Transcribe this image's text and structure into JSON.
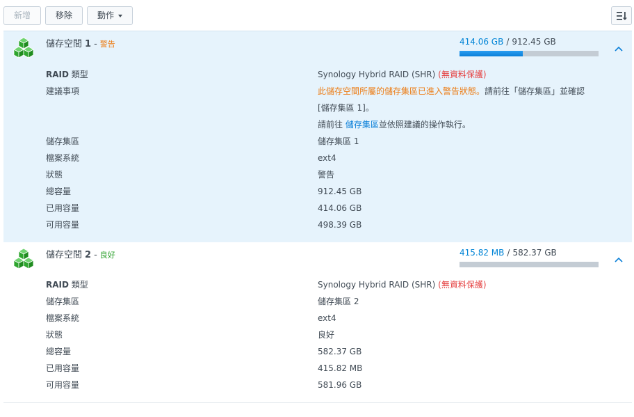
{
  "toolbar": {
    "create_label": "新增",
    "remove_label": "移除",
    "action_label": "動作"
  },
  "volumes": [
    {
      "title": "儲存空間",
      "number": "1",
      "status": "警告",
      "usage_used": "414.06 GB",
      "usage_total": "912.45 GB",
      "usage_fraction": 0.454,
      "raid_key_bold": "RAID",
      "raid_key_rest": "類型",
      "raid_value": "Synology Hybrid RAID (SHR)",
      "raid_note": "(無資料保護)",
      "suggest_key": "建議事項",
      "suggest_line1_warn": "此儲存空間所屬的儲存集區已進入警告狀態。",
      "suggest_line1_rest": "請前往「儲存集區」並確認",
      "suggest_line2": "[儲存集區 1]。",
      "suggest_line3_pre": "請前往",
      "suggest_line3_link": "儲存集區",
      "suggest_line3_post": "並依照建議的操作執行。",
      "pool_key": "儲存集區",
      "pool_value": "儲存集區 1",
      "fs_key": "檔案系統",
      "fs_value": "ext4",
      "status_key": "狀態",
      "status_value": "警告",
      "total_key": "總容量",
      "total_value": "912.45 GB",
      "used_key": "已用容量",
      "used_value": "414.06 GB",
      "avail_key": "可用容量",
      "avail_value": "498.39 GB"
    },
    {
      "title": "儲存空間",
      "number": "2",
      "status": "良好",
      "usage_used": "415.82 MB",
      "usage_total": "582.37 GB",
      "usage_fraction": 0.001,
      "raid_key_bold": "RAID",
      "raid_key_rest": "類型",
      "raid_value": "Synology Hybrid RAID (SHR)",
      "raid_note": "(無資料保護)",
      "pool_key": "儲存集區",
      "pool_value": "儲存集區 2",
      "fs_key": "檔案系統",
      "fs_value": "ext4",
      "status_key": "狀態",
      "status_value": "良好",
      "total_key": "總容量",
      "total_value": "582.37 GB",
      "used_key": "已用容量",
      "used_value": "415.82 MB",
      "avail_key": "可用容量",
      "avail_value": "581.96 GB"
    }
  ],
  "icons": {
    "volume": "volume-cubes-icon",
    "collapse": "chevron-up-icon",
    "sort": "sort-list-icon"
  },
  "colors": {
    "accent": "#0084d6",
    "warning": "#ec7d16",
    "good": "#2aa02a",
    "danger": "#e54343",
    "cube_green": "#3cb83c"
  }
}
